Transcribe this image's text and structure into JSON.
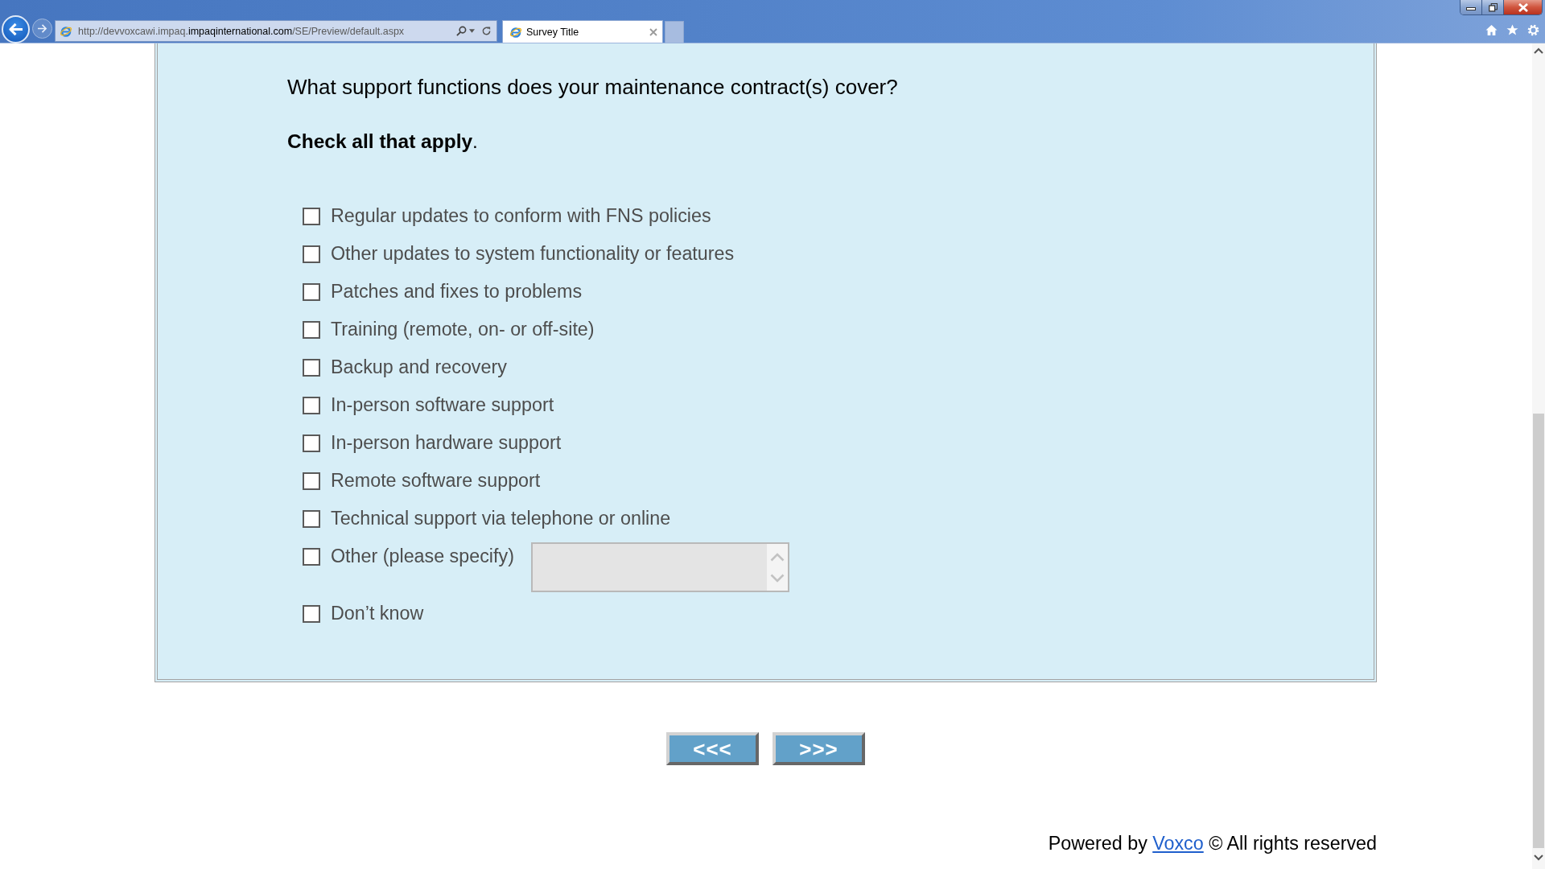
{
  "browser": {
    "address": {
      "before_domain": "http://devvoxcawi.impaq.",
      "domain": "impaqinternational.com",
      "after_domain": "/SE/Preview/default.aspx"
    },
    "tab": {
      "title": "Survey Title"
    }
  },
  "question": {
    "text": "What support functions does your maintenance contract(s) cover?",
    "instruction": "**Check all that apply**."
  },
  "options": [
    {
      "kind": "checkbox",
      "label": "Regular updates to conform with FNS policies",
      "checked": false
    },
    {
      "kind": "checkbox",
      "label": "Other updates to system functionality or features",
      "checked": false
    },
    {
      "kind": "checkbox",
      "label": "Patches and fixes to problems",
      "checked": false
    },
    {
      "kind": "checkbox",
      "label": "Training (remote, on- or off-site)",
      "checked": false
    },
    {
      "kind": "checkbox",
      "label": "Backup and recovery",
      "checked": false
    },
    {
      "kind": "checkbox",
      "label": "In-person software support",
      "checked": false
    },
    {
      "kind": "checkbox",
      "label": "In-person hardware support",
      "checked": false
    },
    {
      "kind": "checkbox",
      "label": "Remote software support",
      "checked": false
    },
    {
      "kind": "checkbox",
      "label": "Technical support via telephone or online",
      "checked": false
    },
    {
      "kind": "other",
      "label": "Other (please specify)",
      "checked": false
    },
    {
      "kind": "checkbox",
      "label": "Don’t know",
      "checked": false
    }
  ],
  "navigation": {
    "buttons": [
      {
        "label": "<<<"
      },
      {
        "label": ">>>"
      }
    ]
  },
  "footer": {
    "prefix": "Powered by",
    "link": "Voxco",
    "suffix": "© All rights reserved"
  }
}
